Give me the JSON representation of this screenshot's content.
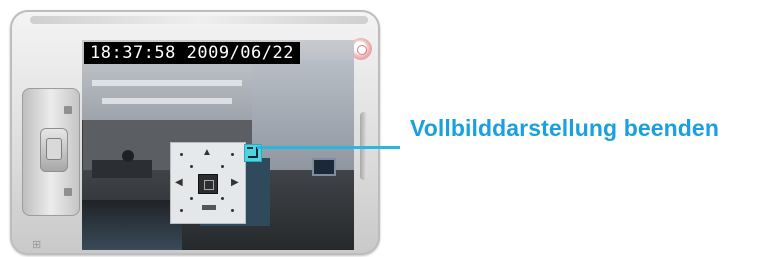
{
  "screen": {
    "timestamp": "18:37:58 2009/06/22"
  },
  "callout": {
    "label": "Vollbilddarstellung beenden",
    "color": "#1a9fe0"
  },
  "ptz_controls": {
    "up_icon": "triangle-up-icon",
    "down_icon": "triangle-down-icon",
    "left_icon": "triangle-left-icon",
    "right_icon": "triangle-right-icon",
    "exit_fullscreen_icon": "exit-fullscreen-icon",
    "exit_button_color": "#4fd2e2"
  }
}
